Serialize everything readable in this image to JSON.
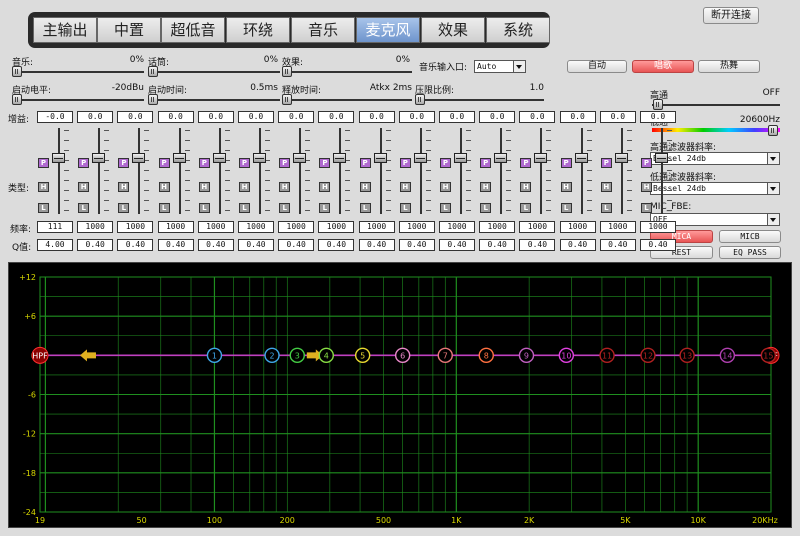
{
  "tabs": [
    {
      "label": "主输出"
    },
    {
      "label": "中置"
    },
    {
      "label": "超低音"
    },
    {
      "label": "环绕"
    },
    {
      "label": "音乐"
    },
    {
      "label": "麦克风",
      "active": true
    },
    {
      "label": "效果"
    },
    {
      "label": "系统"
    }
  ],
  "disconnect_label": "断开连接",
  "mix": {
    "music": {
      "label": "音乐:",
      "value": "0%",
      "level": 0
    },
    "talk": {
      "label": "话筒:",
      "value": "0%",
      "level": 0
    },
    "effect": {
      "label": "效果:",
      "value": "0%",
      "level": 0
    },
    "input": {
      "label": "音乐输入口:",
      "value": "Auto"
    },
    "start_level": {
      "label": "启动电平:",
      "value": "-20dBu",
      "level": 0
    },
    "attack": {
      "label": "启动时间:",
      "value": "0.5ms",
      "level": 0
    },
    "release": {
      "label": "释放时间:",
      "value": "Atkx 2ms",
      "level": 0
    },
    "ratio": {
      "label": "压限比例:",
      "value": "1.0",
      "level": 0
    }
  },
  "modes": {
    "auto": "自动",
    "sing": "唱歌",
    "dance": "热舞",
    "active": "sing"
  },
  "eq": {
    "gain_label": "增益:",
    "type_label": "类型:",
    "freq_label": "频率:",
    "q_label": "Q值:",
    "gains": [
      "-0.0",
      "0.0",
      "0.0",
      "0.0",
      "0.0",
      "0.0",
      "0.0",
      "0.0",
      "0.0",
      "0.0",
      "0.0",
      "0.0",
      "0.0",
      "0.0",
      "0.0",
      "0.0"
    ],
    "freqs": [
      "111",
      "1000",
      "1000",
      "1000",
      "1000",
      "1000",
      "1000",
      "1000",
      "1000",
      "1000",
      "1000",
      "1000",
      "1000",
      "1000",
      "1000",
      "1000"
    ],
    "qs": [
      "4.00",
      "0.40",
      "0.40",
      "0.40",
      "0.40",
      "0.40",
      "0.40",
      "0.40",
      "0.40",
      "0.40",
      "0.40",
      "0.40",
      "0.40",
      "0.40",
      "0.40",
      "0.40"
    ],
    "type_letters": [
      "P",
      "H",
      "L"
    ],
    "types": [
      "P",
      "P",
      "P",
      "P",
      "P",
      "P",
      "P",
      "P",
      "P",
      "P",
      "P",
      "P",
      "P",
      "P",
      "P",
      "P"
    ]
  },
  "filters": {
    "hp_label": "高通",
    "hp_value": "OFF",
    "lp_label": "低通",
    "lp_value": "20600Hz",
    "hp_slope_label": "高通滤波器斜率:",
    "hp_slope": "Bessel 24db",
    "lp_slope_label": "低通滤波器斜率:",
    "lp_slope": "Bessel 24db",
    "fbe_label": "MIC_FBE:",
    "fbe": "OFF",
    "mica": "MICA",
    "micb": "MICB",
    "rest": "REST",
    "eqpass": "EQ PASS"
  },
  "colors": {
    "accent_tab": "#6e94cc",
    "red_button": "#e85454",
    "graph_bg": "#000000",
    "grid": "#1f8f1f",
    "grid_labels": "#d8d800",
    "response_line": "#c040c0",
    "arrow": "#e0b020"
  },
  "graph": {
    "y_labels": [
      "+12",
      "+6",
      "0",
      "-6",
      "-12",
      "-18",
      "-24"
    ],
    "y_values": [
      12,
      6,
      0,
      -6,
      -12,
      -18,
      -24
    ],
    "x_labels": [
      "19",
      "50",
      "100",
      "200",
      "500",
      "1K",
      "2K",
      "5K",
      "10K",
      "20KHz"
    ],
    "x_freqs": [
      19,
      50,
      100,
      200,
      500,
      1000,
      2000,
      5000,
      10000,
      20000
    ],
    "hpf_label": "HPF",
    "lpf_label": "LPF",
    "points": [
      {
        "label": "1",
        "freq": 100,
        "color": "#3fa7e8"
      },
      {
        "label": "2",
        "freq": 173,
        "color": "#3fa7e8"
      },
      {
        "label": "3",
        "freq": 220,
        "color": "#44cc44"
      },
      {
        "label": "4",
        "freq": 290,
        "color": "#88dd44"
      },
      {
        "label": "5",
        "freq": 410,
        "color": "#e8d830"
      },
      {
        "label": "6",
        "freq": 600,
        "color": "#e888c8"
      },
      {
        "label": "7",
        "freq": 900,
        "color": "#e87878"
      },
      {
        "label": "8",
        "freq": 1330,
        "color": "#ff7040"
      },
      {
        "label": "9",
        "freq": 1950,
        "color": "#c060c0"
      },
      {
        "label": "10",
        "freq": 2850,
        "color": "#e040e0"
      },
      {
        "label": "11",
        "freq": 4200,
        "color": "#b02020"
      },
      {
        "label": "12",
        "freq": 6200,
        "color": "#b02020"
      },
      {
        "label": "13",
        "freq": 9000,
        "color": "#b02020"
      },
      {
        "label": "14",
        "freq": 13200,
        "color": "#b040b0"
      },
      {
        "label": "15",
        "freq": 19500,
        "color": "#b02020"
      }
    ]
  }
}
